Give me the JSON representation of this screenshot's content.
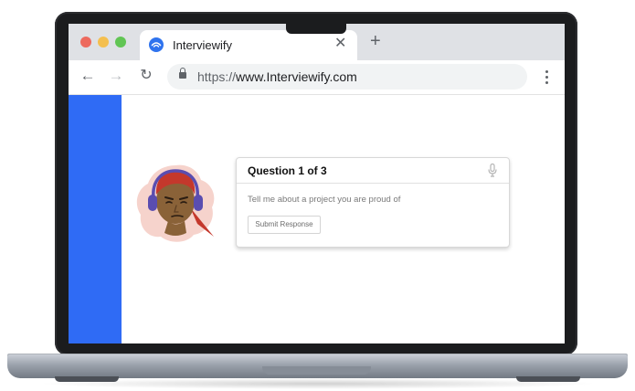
{
  "browser": {
    "tab_title": "Interviewify",
    "tab_close": "✕",
    "new_tab": "+",
    "url_scheme": "https://",
    "url_host": "www.Interviewify.com",
    "back": "←",
    "forward": "→",
    "reload": "↻"
  },
  "card": {
    "title": "Question 1 of 3",
    "question": "Tell me about a project you are proud of",
    "submit_label": "Submit Response"
  },
  "colors": {
    "sidebar": "#2f6bf5",
    "favicon": "#2f73ee",
    "avatar_blob": "#f6d3cc",
    "hair": "#c4382c",
    "headphones": "#5a4db0"
  }
}
